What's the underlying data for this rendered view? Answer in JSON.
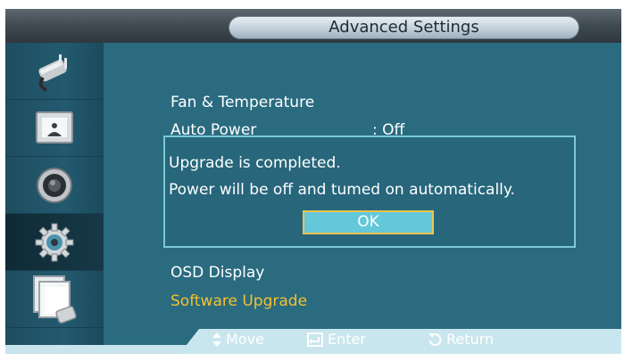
{
  "header": {
    "title": "Advanced Settings"
  },
  "sidebar": {
    "items": [
      {
        "icon": "plug-icon",
        "active": false
      },
      {
        "icon": "picture-icon",
        "active": false
      },
      {
        "icon": "speaker-icon",
        "active": false
      },
      {
        "icon": "gear-icon",
        "active": true
      },
      {
        "icon": "multi-screen-icon",
        "active": false
      }
    ]
  },
  "menu": {
    "fan_temperature": "Fan & Temperature",
    "auto_power": {
      "label": "Auto Power",
      "value": ": Off"
    },
    "osd_display": "OSD Display",
    "software_upgrade": "Software Upgrade"
  },
  "dialog": {
    "line1": "Upgrade is completed.",
    "line2": "Power will be off and tumed on automatically.",
    "ok": "OK"
  },
  "footer": {
    "move": "Move",
    "enter": "Enter",
    "return": "Return"
  },
  "colors": {
    "panel": "#2a6b80",
    "highlight": "#f3c230",
    "ok_button": "#64c7da",
    "footer": "#c9e6ee"
  }
}
